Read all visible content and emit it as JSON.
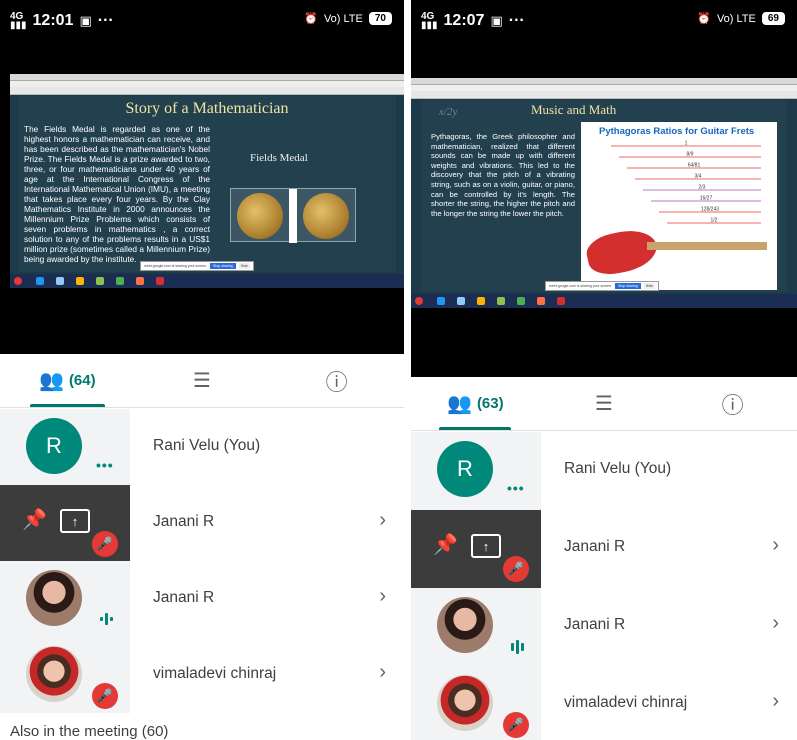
{
  "left": {
    "status": {
      "time": "12:01",
      "battery": "70",
      "network": "4G",
      "lte": "Vo) LTE"
    },
    "slide": {
      "title": "Story of a Mathematician",
      "body": "The Fields Medal is regarded as one of the highest honors a mathematician can receive, and has been described as the mathematician's Nobel Prize. The Fields Medal is a prize awarded to two, three, or four mathematicians under 40 years of age at the International Congress of the International Mathematical Union (IMU), a meeting that takes place every four years. By the Clay Mathematics Institute in 2000 announces the Millennium Prize Problems which consists of seven problems in mathematics , a correct solution to any of the problems results in a US$1 million prize (sometimes called a Millennium Prize) being awarded by the institute.",
      "side_label": "Fields Medal"
    },
    "share_bar": {
      "text": "meet.google.com is sharing your screen.",
      "stop": "Stop sharing",
      "hide": "Hide"
    },
    "tabs": {
      "people": "(64)"
    },
    "participants": [
      {
        "name": "Rani Velu (You)",
        "initial": "R"
      },
      {
        "name": "Janani R"
      },
      {
        "name": "Janani R"
      },
      {
        "name": "vimaladevi chinraj"
      }
    ],
    "also": "Also in the meeting (60)"
  },
  "right": {
    "status": {
      "time": "12:07",
      "battery": "69",
      "network": "4G",
      "lte": "Vo) LTE"
    },
    "slide": {
      "title": "Music and Math",
      "body": "Pythagoras, the Greek philosopher and mathematician, realized that different sounds can be made up with different weights and vibrations. This led to the discovery that the pitch of a vibrating string, such as on a violin, guitar, or piano, can be controlled by it's length. The shorter the string, the higher the pitch and the longer the string the lower the pitch.",
      "chart_title": "Pythagoras Ratios for Guitar Frets",
      "chart_labels": [
        "1",
        "8/9",
        "64/81",
        "3/4",
        "2/3",
        "16/27",
        "128/243",
        "1/2"
      ]
    },
    "share_bar": {
      "text": "meet.google.com is sharing your screen.",
      "stop": "Stop sharing",
      "hide": "Hide"
    },
    "tabs": {
      "people": "(63)"
    },
    "participants": [
      {
        "name": "Rani Velu (You)",
        "initial": "R"
      },
      {
        "name": "Janani R"
      },
      {
        "name": "Janani R"
      },
      {
        "name": "vimaladevi chinraj"
      }
    ]
  }
}
